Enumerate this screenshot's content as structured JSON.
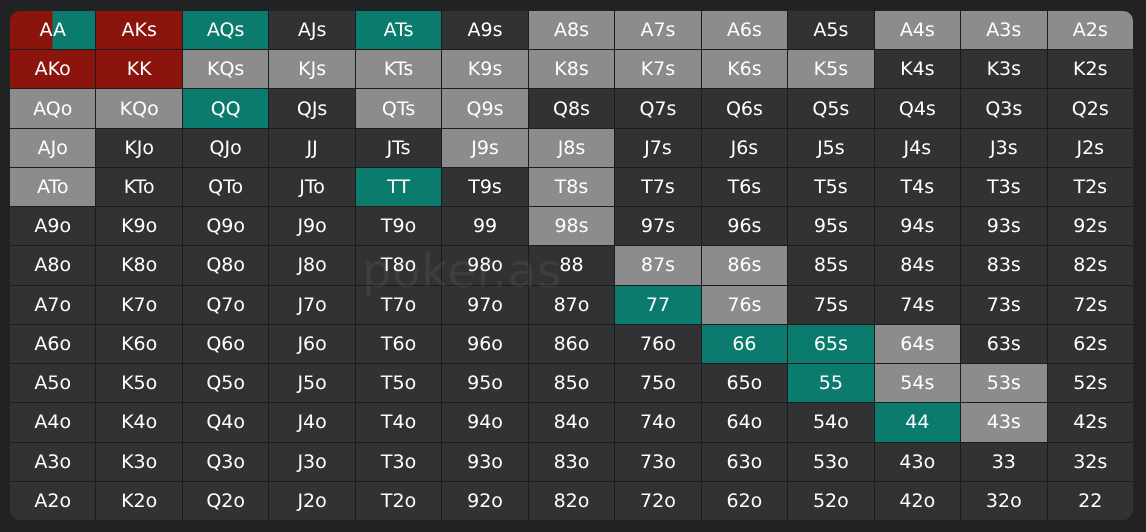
{
  "colors": {
    "default": "#303234",
    "raise": "#8c8c8c",
    "call": "#0b7b6d",
    "fold4bet": "#8b150d"
  },
  "watermark": "poker.as",
  "grid": [
    [
      [
        "AA",
        "mixed"
      ],
      [
        "AKs",
        "fold4bet"
      ],
      [
        "AQs",
        "call"
      ],
      [
        "AJs",
        ""
      ],
      [
        "ATs",
        "call"
      ],
      [
        "A9s",
        ""
      ],
      [
        "A8s",
        "raise"
      ],
      [
        "A7s",
        "raise"
      ],
      [
        "A6s",
        "raise"
      ],
      [
        "A5s",
        ""
      ],
      [
        "A4s",
        "raise"
      ],
      [
        "A3s",
        "raise"
      ],
      [
        "A2s",
        "raise"
      ]
    ],
    [
      [
        "AKo",
        "fold4bet"
      ],
      [
        "KK",
        "fold4bet"
      ],
      [
        "KQs",
        "raise"
      ],
      [
        "KJs",
        "raise"
      ],
      [
        "KTs",
        "raise"
      ],
      [
        "K9s",
        "raise"
      ],
      [
        "K8s",
        "raise"
      ],
      [
        "K7s",
        "raise"
      ],
      [
        "K6s",
        "raise"
      ],
      [
        "K5s",
        "raise"
      ],
      [
        "K4s",
        ""
      ],
      [
        "K3s",
        ""
      ],
      [
        "K2s",
        ""
      ]
    ],
    [
      [
        "AQo",
        "raise"
      ],
      [
        "KQo",
        "raise"
      ],
      [
        "QQ",
        "call"
      ],
      [
        "QJs",
        ""
      ],
      [
        "QTs",
        "raise"
      ],
      [
        "Q9s",
        "raise"
      ],
      [
        "Q8s",
        ""
      ],
      [
        "Q7s",
        ""
      ],
      [
        "Q6s",
        ""
      ],
      [
        "Q5s",
        ""
      ],
      [
        "Q4s",
        ""
      ],
      [
        "Q3s",
        ""
      ],
      [
        "Q2s",
        ""
      ]
    ],
    [
      [
        "AJo",
        "raise"
      ],
      [
        "KJo",
        ""
      ],
      [
        "QJo",
        ""
      ],
      [
        "JJ",
        ""
      ],
      [
        "JTs",
        ""
      ],
      [
        "J9s",
        "raise"
      ],
      [
        "J8s",
        "raise"
      ],
      [
        "J7s",
        ""
      ],
      [
        "J6s",
        ""
      ],
      [
        "J5s",
        ""
      ],
      [
        "J4s",
        ""
      ],
      [
        "J3s",
        ""
      ],
      [
        "J2s",
        ""
      ]
    ],
    [
      [
        "ATo",
        "raise"
      ],
      [
        "KTo",
        ""
      ],
      [
        "QTo",
        ""
      ],
      [
        "JTo",
        ""
      ],
      [
        "TT",
        "call"
      ],
      [
        "T9s",
        ""
      ],
      [
        "T8s",
        "raise"
      ],
      [
        "T7s",
        ""
      ],
      [
        "T6s",
        ""
      ],
      [
        "T5s",
        ""
      ],
      [
        "T4s",
        ""
      ],
      [
        "T3s",
        ""
      ],
      [
        "T2s",
        ""
      ]
    ],
    [
      [
        "A9o",
        ""
      ],
      [
        "K9o",
        ""
      ],
      [
        "Q9o",
        ""
      ],
      [
        "J9o",
        ""
      ],
      [
        "T9o",
        ""
      ],
      [
        "99",
        ""
      ],
      [
        "98s",
        "raise"
      ],
      [
        "97s",
        ""
      ],
      [
        "96s",
        ""
      ],
      [
        "95s",
        ""
      ],
      [
        "94s",
        ""
      ],
      [
        "93s",
        ""
      ],
      [
        "92s",
        ""
      ]
    ],
    [
      [
        "A8o",
        ""
      ],
      [
        "K8o",
        ""
      ],
      [
        "Q8o",
        ""
      ],
      [
        "J8o",
        ""
      ],
      [
        "T8o",
        ""
      ],
      [
        "98o",
        ""
      ],
      [
        "88",
        ""
      ],
      [
        "87s",
        "raise"
      ],
      [
        "86s",
        "raise"
      ],
      [
        "85s",
        ""
      ],
      [
        "84s",
        ""
      ],
      [
        "83s",
        ""
      ],
      [
        "82s",
        ""
      ]
    ],
    [
      [
        "A7o",
        ""
      ],
      [
        "K7o",
        ""
      ],
      [
        "Q7o",
        ""
      ],
      [
        "J7o",
        ""
      ],
      [
        "T7o",
        ""
      ],
      [
        "97o",
        ""
      ],
      [
        "87o",
        ""
      ],
      [
        "77",
        "call"
      ],
      [
        "76s",
        "raise"
      ],
      [
        "75s",
        ""
      ],
      [
        "74s",
        ""
      ],
      [
        "73s",
        ""
      ],
      [
        "72s",
        ""
      ]
    ],
    [
      [
        "A6o",
        ""
      ],
      [
        "K6o",
        ""
      ],
      [
        "Q6o",
        ""
      ],
      [
        "J6o",
        ""
      ],
      [
        "T6o",
        ""
      ],
      [
        "96o",
        ""
      ],
      [
        "86o",
        ""
      ],
      [
        "76o",
        ""
      ],
      [
        "66",
        "call"
      ],
      [
        "65s",
        "call"
      ],
      [
        "64s",
        "raise"
      ],
      [
        "63s",
        ""
      ],
      [
        "62s",
        ""
      ]
    ],
    [
      [
        "A5o",
        ""
      ],
      [
        "K5o",
        ""
      ],
      [
        "Q5o",
        ""
      ],
      [
        "J5o",
        ""
      ],
      [
        "T5o",
        ""
      ],
      [
        "95o",
        ""
      ],
      [
        "85o",
        ""
      ],
      [
        "75o",
        ""
      ],
      [
        "65o",
        ""
      ],
      [
        "55",
        "call"
      ],
      [
        "54s",
        "raise"
      ],
      [
        "53s",
        "raise"
      ],
      [
        "52s",
        ""
      ]
    ],
    [
      [
        "A4o",
        ""
      ],
      [
        "K4o",
        ""
      ],
      [
        "Q4o",
        ""
      ],
      [
        "J4o",
        ""
      ],
      [
        "T4o",
        ""
      ],
      [
        "94o",
        ""
      ],
      [
        "84o",
        ""
      ],
      [
        "74o",
        ""
      ],
      [
        "64o",
        ""
      ],
      [
        "54o",
        ""
      ],
      [
        "44",
        "call"
      ],
      [
        "43s",
        "raise"
      ],
      [
        "42s",
        ""
      ]
    ],
    [
      [
        "A3o",
        ""
      ],
      [
        "K3o",
        ""
      ],
      [
        "Q3o",
        ""
      ],
      [
        "J3o",
        ""
      ],
      [
        "T3o",
        ""
      ],
      [
        "93o",
        ""
      ],
      [
        "83o",
        ""
      ],
      [
        "73o",
        ""
      ],
      [
        "63o",
        ""
      ],
      [
        "53o",
        ""
      ],
      [
        "43o",
        ""
      ],
      [
        "33",
        ""
      ],
      [
        "32s",
        ""
      ]
    ],
    [
      [
        "A2o",
        ""
      ],
      [
        "K2o",
        ""
      ],
      [
        "Q2o",
        ""
      ],
      [
        "J2o",
        ""
      ],
      [
        "T2o",
        ""
      ],
      [
        "92o",
        ""
      ],
      [
        "82o",
        ""
      ],
      [
        "72o",
        ""
      ],
      [
        "62o",
        ""
      ],
      [
        "52o",
        ""
      ],
      [
        "42o",
        ""
      ],
      [
        "32o",
        ""
      ],
      [
        "22",
        ""
      ]
    ]
  ]
}
